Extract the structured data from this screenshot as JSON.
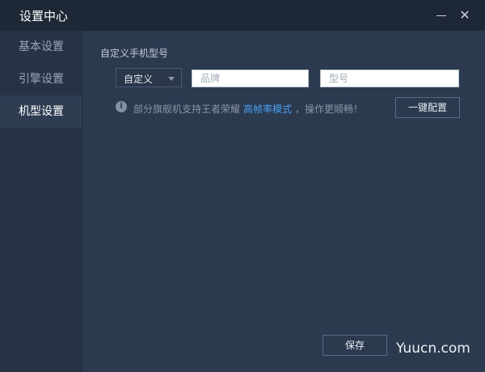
{
  "window": {
    "title": "设置中心",
    "minimize_icon": "minimize-icon",
    "close_icon": "close-icon"
  },
  "sidebar": {
    "items": [
      {
        "label": "基本设置",
        "active": false
      },
      {
        "label": "引擎设置",
        "active": false
      },
      {
        "label": "机型设置",
        "active": true
      }
    ]
  },
  "main": {
    "section_label": "自定义手机型号",
    "device_select": {
      "value": "自定义"
    },
    "brand_input": {
      "value": "",
      "placeholder": "品牌"
    },
    "model_input": {
      "value": "",
      "placeholder": "型号"
    },
    "info": {
      "icon": "info-icon",
      "text": "部分旗舰机支持王者荣耀",
      "link": "高帧率模式",
      "tail": "，操作更顺畅！"
    },
    "oneclick_button": "一键配置",
    "save_button": "保存"
  },
  "watermark": "Yuucn.com",
  "colors": {
    "background": "#2c3a50",
    "titlebar": "#1e2736",
    "sidebar": "#263245",
    "sidebar_active": "#2f3d53",
    "link": "#4aa0f0"
  }
}
